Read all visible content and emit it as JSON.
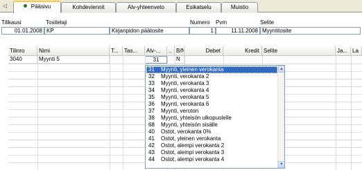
{
  "tabs": [
    {
      "label": "Pääsivu",
      "active": true
    },
    {
      "label": "Kohdeviennit",
      "active": false
    },
    {
      "label": "Alv-yhteenveto",
      "active": false
    },
    {
      "label": "Esikatselu",
      "active": false
    },
    {
      "label": "Muistio",
      "active": false
    }
  ],
  "header": {
    "labels": {
      "tilikausi": "Tilikausi",
      "tositelaji": "Tositelaji",
      "numero": "Numero",
      "pvm": "Pvm",
      "selite": "Selite"
    },
    "values": {
      "tilikausi": "01.01.2008",
      "tositelaji_code": "KP",
      "tositelaji_name": "Kirjanpidon päätosite",
      "numero": "1",
      "pvm": "11.11.2008",
      "selite": "Myyntitosite"
    }
  },
  "grid": {
    "columns": [
      "Tilinro",
      "Nimi",
      "T...",
      "Tas...",
      "Alv-...",
      "..",
      "B/N",
      "Debet",
      "Kredit",
      "Selite",
      "Ja...",
      "La"
    ],
    "rows": [
      {
        "tilinro": "3040",
        "nimi": "Myynti 5",
        "alv": "31",
        "bn": "N"
      }
    ]
  },
  "dropdown": {
    "items": [
      {
        "code": "31",
        "desc": "Myynti, yleinen verokanta",
        "selected": true
      },
      {
        "code": "32",
        "desc": "Myynti, verokanta 2"
      },
      {
        "code": "33",
        "desc": "Myynti, verokanta 3"
      },
      {
        "code": "34",
        "desc": "Myynti, verokanta 4"
      },
      {
        "code": "35",
        "desc": "Myynti, verokanta 5"
      },
      {
        "code": "36",
        "desc": "Myynti, verokanta 6"
      },
      {
        "code": "37",
        "desc": "Myynti, veroton"
      },
      {
        "code": "38",
        "desc": "Myynti, yhteisön ulkopuolelle"
      },
      {
        "code": "68",
        "desc": "Myynti, yhteisön sisälle"
      },
      {
        "code": "40",
        "desc": "Ostot, verokanta 0%"
      },
      {
        "code": "41",
        "desc": "Ostot, yleinen verokanta"
      },
      {
        "code": "42",
        "desc": "Ostot, alempi verokanta 2"
      },
      {
        "code": "43",
        "desc": "Ostot, alempi verokanta 3"
      },
      {
        "code": "44",
        "desc": "Ostot, alempi verokanta 4"
      }
    ]
  }
}
